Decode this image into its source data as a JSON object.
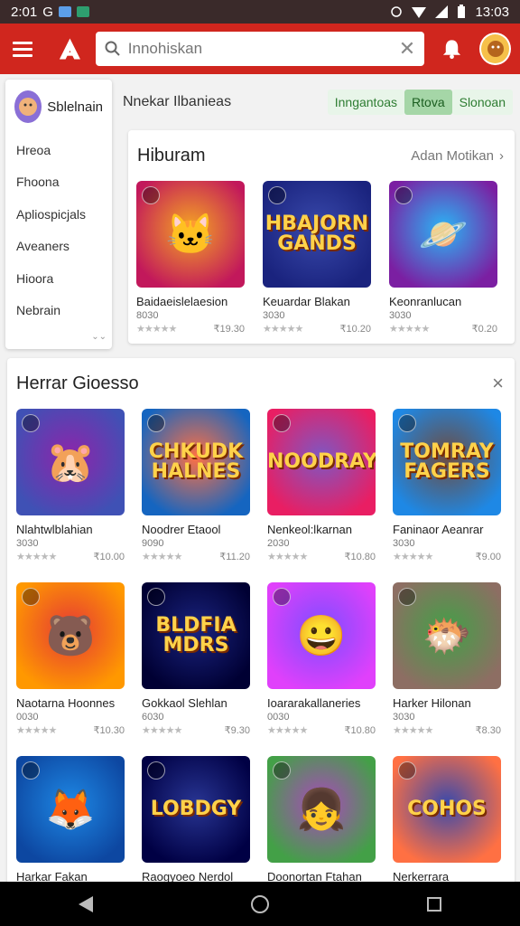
{
  "status": {
    "time_left": "2:01",
    "g": "G",
    "time_right": "13:03"
  },
  "search": {
    "placeholder": "Innohiskan",
    "value": ""
  },
  "drawer": {
    "name": "Sblelnain",
    "items": [
      "Hreoa",
      "Fhoona",
      "Apliospicjals",
      "Aveaners",
      "Hioora",
      "Nebrain"
    ]
  },
  "top_bar": {
    "title": "Nnekar Ilbanieas",
    "chips": [
      "Inngantoas",
      "Rtova",
      "Slonoan"
    ]
  },
  "section1": {
    "title": "Hiburam",
    "link": "Adan Motikan",
    "games": [
      {
        "name": "Baidaeislelaesion",
        "sub": "8030",
        "price": "₹19.30",
        "word": "",
        "icon": "cat-mascot-icon",
        "color1": "#f5a623",
        "color2": "#c2185b"
      },
      {
        "name": "Keuardar Blakan",
        "sub": "3030",
        "price": "₹10.20",
        "word": "HBAJORN GANDS",
        "icon": "",
        "color1": "#3949ab",
        "color2": "#1a237e"
      },
      {
        "name": "Keonranlucan",
        "sub": "3030",
        "price": "₹0.20",
        "word": "",
        "icon": "planet-icon",
        "color1": "#29b6f6",
        "color2": "#7b1fa2"
      }
    ]
  },
  "section2": {
    "title": "Herrar Gioesso",
    "games": [
      {
        "name": "Nlahtwlblahian",
        "sub": "3030",
        "price": "₹10.00",
        "word": "",
        "icon": "hamster-icon",
        "color1": "#8e24aa",
        "color2": "#3f51b5"
      },
      {
        "name": "Noodrer Etaool",
        "sub": "9090",
        "price": "₹11.20",
        "word": "CHKUDK HALNES",
        "icon": "",
        "color1": "#ff7043",
        "color2": "#1565c0"
      },
      {
        "name": "Nenkeol:lkarnan",
        "sub": "2030",
        "price": "₹10.80",
        "word": "NOODRAY",
        "icon": "",
        "color1": "#7e57c2",
        "color2": "#e91e63"
      },
      {
        "name": "Faninaor Aeanrar",
        "sub": "3030",
        "price": "₹9.00",
        "word": "TOMRAY FAGERS",
        "icon": "",
        "color1": "#6d4c41",
        "color2": "#1e88e5"
      },
      {
        "name": "Naotarna Hoonnes",
        "sub": "0030",
        "price": "₹10.30",
        "word": "",
        "icon": "soldier-cat-icon",
        "color1": "#e53935",
        "color2": "#ff9800"
      },
      {
        "name": "Gokkaol Slehlan",
        "sub": "6030",
        "price": "₹9.30",
        "word": "BLDFIA MDRS",
        "icon": "",
        "color1": "#1a237e",
        "color2": "#000033"
      },
      {
        "name": "Ioararakallaneries",
        "sub": "0030",
        "price": "₹10.80",
        "word": "",
        "icon": "smiley-icon",
        "color1": "#7c4dff",
        "color2": "#e040fb"
      },
      {
        "name": "Harker Hilonan",
        "sub": "3030",
        "price": "₹8.30",
        "word": "",
        "icon": "blob-icon",
        "color1": "#43a047",
        "color2": "#8d6e63"
      },
      {
        "name": "Harkar Fakan",
        "sub": "",
        "price": "",
        "word": "",
        "icon": "fox-icon",
        "color1": "#1e88e5",
        "color2": "#0d47a1"
      },
      {
        "name": "Raogyoeo Nerdol",
        "sub": "",
        "price": "",
        "word": "LOBDGY",
        "icon": "",
        "color1": "#283593",
        "color2": "#000044"
      },
      {
        "name": "Doonortan Ftahan",
        "sub": "",
        "price": "",
        "word": "",
        "icon": "girl-icon",
        "color1": "#ab47bc",
        "color2": "#43a047"
      },
      {
        "name": "Nerkerrara",
        "sub": "",
        "price": "",
        "word": "COHOS",
        "icon": "",
        "color1": "#3949ab",
        "color2": "#ff7043"
      }
    ]
  }
}
